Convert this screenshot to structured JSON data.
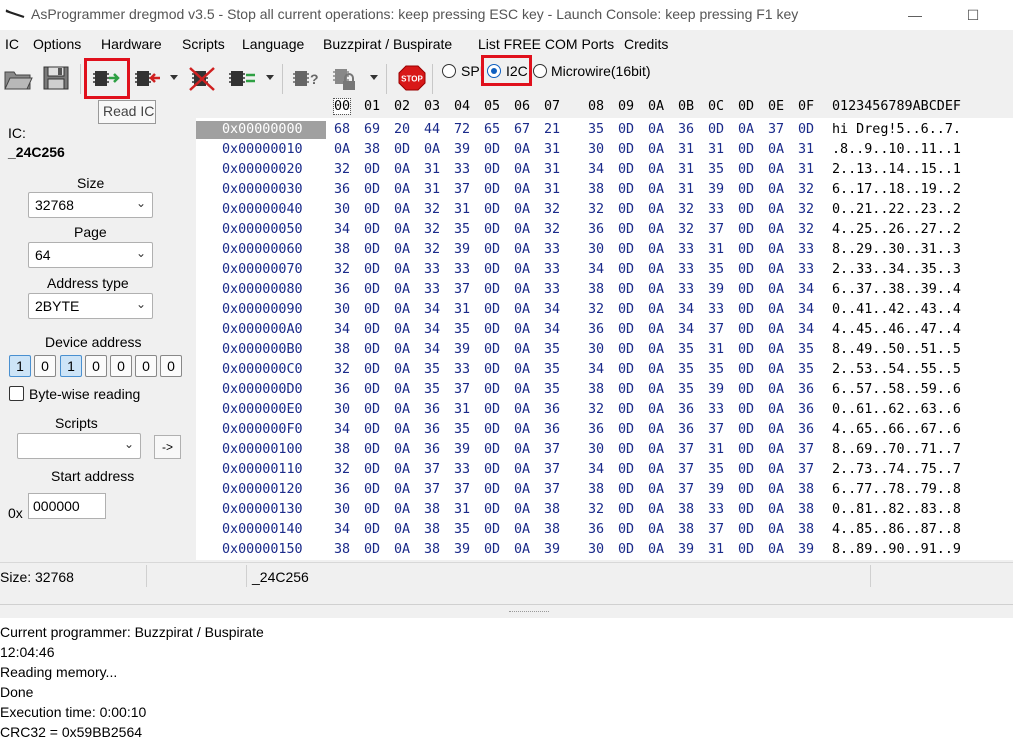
{
  "window": {
    "title": "AsProgrammer dregmod v3.5 - Stop all current operations: keep pressing ESC key - Launch Console: keep pressing F1 key",
    "minimize_glyph": "—",
    "maximize_glyph": "☐"
  },
  "menu": [
    "IC",
    "Options",
    "Hardware",
    "Scripts",
    "Language",
    "Buzzpirat / Buspirate",
    "List FREE COM Ports",
    "Credits"
  ],
  "toolbar": {
    "tooltip": "Read IC",
    "protocols": [
      {
        "label": "SPI",
        "checked": false
      },
      {
        "label": "I2C",
        "checked": true
      },
      {
        "label": "Microwire(16bit)",
        "checked": false
      }
    ],
    "icons": [
      "open-file-icon",
      "save-icon",
      "read-ic-icon",
      "write-ic-icon",
      "erase-ic-icon",
      "verify-ic-icon",
      "chip-info-icon",
      "chip-lock-icon",
      "stop-icon"
    ],
    "stop_text": "STOP"
  },
  "left": {
    "ic_label": "IC:",
    "ic_name": "_24C256",
    "size_label": "Size",
    "size_value": "32768",
    "page_label": "Page",
    "page_value": "64",
    "address_type_label": "Address type",
    "address_type_value": "2BYTE",
    "device_address_label": "Device address",
    "device_address_bits": [
      "1",
      "0",
      "1",
      "0",
      "0",
      "0",
      "0"
    ],
    "byte_wise_label": "Byte-wise reading",
    "scripts_label": "Scripts",
    "scripts_value": "",
    "run_script_label": "->",
    "start_address_label": "Start address",
    "start_address_prefix": "0x",
    "start_address_value": "000000"
  },
  "hex": {
    "column_headers": [
      "00",
      "01",
      "02",
      "03",
      "04",
      "05",
      "06",
      "07",
      "08",
      "09",
      "0A",
      "0B",
      "0C",
      "0D",
      "0E",
      "0F"
    ],
    "ascii_header": "0123456789ABCDEF",
    "rows": [
      {
        "addr": "0x00000000",
        "bytes": [
          "68",
          "69",
          "20",
          "44",
          "72",
          "65",
          "67",
          "21",
          "35",
          "0D",
          "0A",
          "36",
          "0D",
          "0A",
          "37",
          "0D"
        ],
        "ascii": "hi Dreg!5..6..7."
      },
      {
        "addr": "0x00000010",
        "bytes": [
          "0A",
          "38",
          "0D",
          "0A",
          "39",
          "0D",
          "0A",
          "31",
          "30",
          "0D",
          "0A",
          "31",
          "31",
          "0D",
          "0A",
          "31"
        ],
        "ascii": ".8..9..10..11..1"
      },
      {
        "addr": "0x00000020",
        "bytes": [
          "32",
          "0D",
          "0A",
          "31",
          "33",
          "0D",
          "0A",
          "31",
          "34",
          "0D",
          "0A",
          "31",
          "35",
          "0D",
          "0A",
          "31"
        ],
        "ascii": "2..13..14..15..1"
      },
      {
        "addr": "0x00000030",
        "bytes": [
          "36",
          "0D",
          "0A",
          "31",
          "37",
          "0D",
          "0A",
          "31",
          "38",
          "0D",
          "0A",
          "31",
          "39",
          "0D",
          "0A",
          "32"
        ],
        "ascii": "6..17..18..19..2"
      },
      {
        "addr": "0x00000040",
        "bytes": [
          "30",
          "0D",
          "0A",
          "32",
          "31",
          "0D",
          "0A",
          "32",
          "32",
          "0D",
          "0A",
          "32",
          "33",
          "0D",
          "0A",
          "32"
        ],
        "ascii": "0..21..22..23..2"
      },
      {
        "addr": "0x00000050",
        "bytes": [
          "34",
          "0D",
          "0A",
          "32",
          "35",
          "0D",
          "0A",
          "32",
          "36",
          "0D",
          "0A",
          "32",
          "37",
          "0D",
          "0A",
          "32"
        ],
        "ascii": "4..25..26..27..2"
      },
      {
        "addr": "0x00000060",
        "bytes": [
          "38",
          "0D",
          "0A",
          "32",
          "39",
          "0D",
          "0A",
          "33",
          "30",
          "0D",
          "0A",
          "33",
          "31",
          "0D",
          "0A",
          "33"
        ],
        "ascii": "8..29..30..31..3"
      },
      {
        "addr": "0x00000070",
        "bytes": [
          "32",
          "0D",
          "0A",
          "33",
          "33",
          "0D",
          "0A",
          "33",
          "34",
          "0D",
          "0A",
          "33",
          "35",
          "0D",
          "0A",
          "33"
        ],
        "ascii": "2..33..34..35..3"
      },
      {
        "addr": "0x00000080",
        "bytes": [
          "36",
          "0D",
          "0A",
          "33",
          "37",
          "0D",
          "0A",
          "33",
          "38",
          "0D",
          "0A",
          "33",
          "39",
          "0D",
          "0A",
          "34"
        ],
        "ascii": "6..37..38..39..4"
      },
      {
        "addr": "0x00000090",
        "bytes": [
          "30",
          "0D",
          "0A",
          "34",
          "31",
          "0D",
          "0A",
          "34",
          "32",
          "0D",
          "0A",
          "34",
          "33",
          "0D",
          "0A",
          "34"
        ],
        "ascii": "0..41..42..43..4"
      },
      {
        "addr": "0x000000A0",
        "bytes": [
          "34",
          "0D",
          "0A",
          "34",
          "35",
          "0D",
          "0A",
          "34",
          "36",
          "0D",
          "0A",
          "34",
          "37",
          "0D",
          "0A",
          "34"
        ],
        "ascii": "4..45..46..47..4"
      },
      {
        "addr": "0x000000B0",
        "bytes": [
          "38",
          "0D",
          "0A",
          "34",
          "39",
          "0D",
          "0A",
          "35",
          "30",
          "0D",
          "0A",
          "35",
          "31",
          "0D",
          "0A",
          "35"
        ],
        "ascii": "8..49..50..51..5"
      },
      {
        "addr": "0x000000C0",
        "bytes": [
          "32",
          "0D",
          "0A",
          "35",
          "33",
          "0D",
          "0A",
          "35",
          "34",
          "0D",
          "0A",
          "35",
          "35",
          "0D",
          "0A",
          "35"
        ],
        "ascii": "2..53..54..55..5"
      },
      {
        "addr": "0x000000D0",
        "bytes": [
          "36",
          "0D",
          "0A",
          "35",
          "37",
          "0D",
          "0A",
          "35",
          "38",
          "0D",
          "0A",
          "35",
          "39",
          "0D",
          "0A",
          "36"
        ],
        "ascii": "6..57..58..59..6"
      },
      {
        "addr": "0x000000E0",
        "bytes": [
          "30",
          "0D",
          "0A",
          "36",
          "31",
          "0D",
          "0A",
          "36",
          "32",
          "0D",
          "0A",
          "36",
          "33",
          "0D",
          "0A",
          "36"
        ],
        "ascii": "0..61..62..63..6"
      },
      {
        "addr": "0x000000F0",
        "bytes": [
          "34",
          "0D",
          "0A",
          "36",
          "35",
          "0D",
          "0A",
          "36",
          "36",
          "0D",
          "0A",
          "36",
          "37",
          "0D",
          "0A",
          "36"
        ],
        "ascii": "4..65..66..67..6"
      },
      {
        "addr": "0x00000100",
        "bytes": [
          "38",
          "0D",
          "0A",
          "36",
          "39",
          "0D",
          "0A",
          "37",
          "30",
          "0D",
          "0A",
          "37",
          "31",
          "0D",
          "0A",
          "37"
        ],
        "ascii": "8..69..70..71..7"
      },
      {
        "addr": "0x00000110",
        "bytes": [
          "32",
          "0D",
          "0A",
          "37",
          "33",
          "0D",
          "0A",
          "37",
          "34",
          "0D",
          "0A",
          "37",
          "35",
          "0D",
          "0A",
          "37"
        ],
        "ascii": "2..73..74..75..7"
      },
      {
        "addr": "0x00000120",
        "bytes": [
          "36",
          "0D",
          "0A",
          "37",
          "37",
          "0D",
          "0A",
          "37",
          "38",
          "0D",
          "0A",
          "37",
          "39",
          "0D",
          "0A",
          "38"
        ],
        "ascii": "6..77..78..79..8"
      },
      {
        "addr": "0x00000130",
        "bytes": [
          "30",
          "0D",
          "0A",
          "38",
          "31",
          "0D",
          "0A",
          "38",
          "32",
          "0D",
          "0A",
          "38",
          "33",
          "0D",
          "0A",
          "38"
        ],
        "ascii": "0..81..82..83..8"
      },
      {
        "addr": "0x00000140",
        "bytes": [
          "34",
          "0D",
          "0A",
          "38",
          "35",
          "0D",
          "0A",
          "38",
          "36",
          "0D",
          "0A",
          "38",
          "37",
          "0D",
          "0A",
          "38"
        ],
        "ascii": "4..85..86..87..8"
      },
      {
        "addr": "0x00000150",
        "bytes": [
          "38",
          "0D",
          "0A",
          "38",
          "39",
          "0D",
          "0A",
          "39",
          "30",
          "0D",
          "0A",
          "39",
          "31",
          "0D",
          "0A",
          "39"
        ],
        "ascii": "8..89..90..91..9"
      }
    ]
  },
  "status": {
    "size_text": "Size: 32768",
    "ic_text": "_24C256"
  },
  "log": [
    "Current programmer: Buzzpirat / Buspirate",
    "12:04:46",
    "Reading memory...",
    "Done",
    "Execution time: 0:00:10",
    "CRC32 = 0x59BB2564"
  ],
  "colors": {
    "highlight_red": "#e0101c",
    "hex_blue": "#1a2a8a",
    "radio_blue": "#1060c0"
  }
}
